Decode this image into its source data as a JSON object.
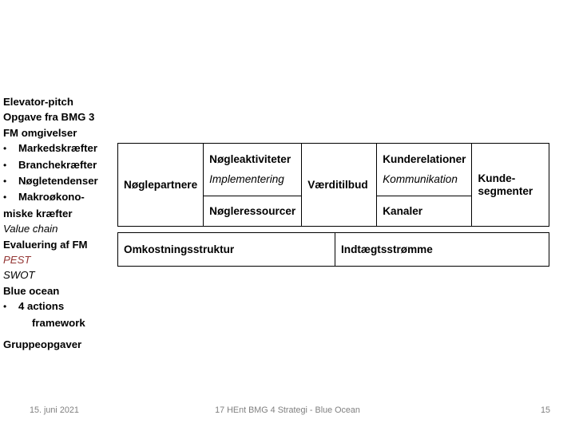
{
  "slide": {
    "left_column": {
      "lines": [
        {
          "text": "Elevator-pitch",
          "style": "bold"
        },
        {
          "text": "Opgave fra BMG 3",
          "style": "bold"
        },
        {
          "text": "FM omgivelser",
          "style": "bold"
        },
        {
          "text": "Markedskræfter",
          "style": "bullet"
        },
        {
          "text": "Branchekræfter",
          "style": "bullet"
        },
        {
          "text": "Nøgletendenser",
          "style": "bullet"
        },
        {
          "text": "Makroøkono-",
          "style": "bullet"
        },
        {
          "text": "miske kræfter",
          "style": "bold"
        },
        {
          "text": "Value chain",
          "style": "italic"
        },
        {
          "text": "Evaluering af FM",
          "style": "bold"
        },
        {
          "text": "PEST",
          "style": "italic-red"
        },
        {
          "text": "SWOT",
          "style": "italic"
        },
        {
          "text": "Blue ocean",
          "style": "bold"
        },
        {
          "text": "4 actions",
          "style": "bullet"
        },
        {
          "text": "framework",
          "style": "bullet-continuation"
        },
        {
          "text": "Gruppeopgaver",
          "style": "bold"
        }
      ],
      "bullet_glyph": "•",
      "pest_color": "#943634"
    },
    "bmg_canvas": {
      "top_row": [
        {
          "key": "key_partners",
          "label": "Nøglepartnere",
          "sub": ""
        },
        {
          "key": "key_activities",
          "label": "Nøgleaktiviteter",
          "sub": "Implementering"
        },
        {
          "key": "key_resources",
          "label": "Nøgleressourcer",
          "sub": ""
        },
        {
          "key": "value_proposition",
          "label": "Værditilbud",
          "sub": ""
        },
        {
          "key": "customer_relationships",
          "label": "Kunderelationer",
          "sub": "Kommunikation"
        },
        {
          "key": "channels",
          "label": "Kanaler",
          "sub": ""
        },
        {
          "key": "customer_segments",
          "label": "Kunde-\nsegmenter",
          "sub": ""
        }
      ],
      "bottom_row": [
        {
          "key": "cost_structure",
          "label": "Omkostningsstruktur"
        },
        {
          "key": "revenue_streams",
          "label": "Indtægtsstrømme"
        }
      ]
    },
    "footer": {
      "date": "15. juni 2021",
      "center": "17 HEnt  BMG 4 Strategi - Blue Ocean",
      "page": "15"
    }
  }
}
